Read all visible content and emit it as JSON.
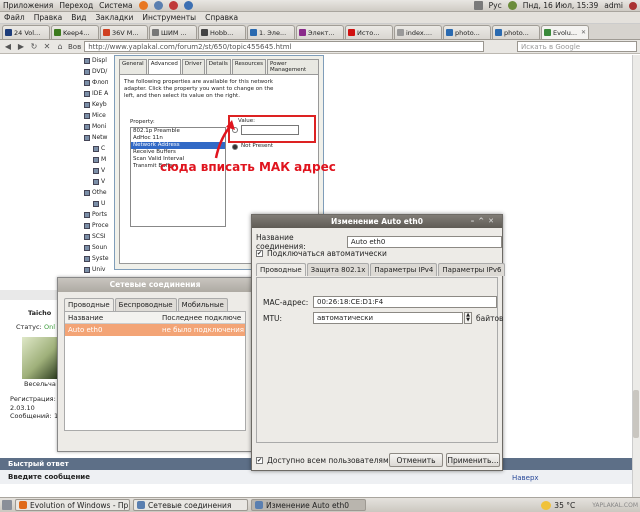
{
  "top_panel": {
    "menus": [
      "Приложения",
      "Переход",
      "Система"
    ],
    "layout": "Рус",
    "clock": "Пнд, 16 Июл, 15:39",
    "user": "admi"
  },
  "menubar": [
    "Файл",
    "Правка",
    "Вид",
    "Закладки",
    "Инструменты",
    "Справка"
  ],
  "tabs": [
    {
      "label": "24 Vol...",
      "color": "#1d3c7a"
    },
    {
      "label": "Keep4...",
      "color": "#3c7a1d"
    },
    {
      "label": "36V M...",
      "color": "#d04020"
    },
    {
      "label": "ШИМ ...",
      "color": "#777777"
    },
    {
      "label": "Hobb...",
      "color": "#444444"
    },
    {
      "label": "1. Эле...",
      "color": "#2a6ab0"
    },
    {
      "label": "Элект...",
      "color": "#8a2a8a"
    },
    {
      "label": "Исто...",
      "color": "#d01010"
    },
    {
      "label": "index....",
      "color": "#999999"
    },
    {
      "label": "photo...",
      "color": "#2a6ab0"
    },
    {
      "label": "photo...",
      "color": "#2a6ab0"
    },
    {
      "label": "Evolu...",
      "color": "#3a8a3a",
      "active": true
    }
  ],
  "navbar": {
    "url_prefix": "Вов",
    "url": "http://www.yaplakal.com/forum2/st/650/topic455645.html",
    "search_placeholder": "Искать в Google"
  },
  "device_tree": [
    "Displ",
    "DVD/",
    "Флоп",
    "IDE A",
    "Keyb",
    "Mice",
    "Moni",
    "Netw",
    "C",
    "M",
    "V",
    "V",
    "Othe",
    "U",
    "Ports",
    "Proce",
    "SCSI",
    "Soun",
    "Syste",
    "Univ"
  ],
  "prop_dialog": {
    "tabs": [
      "General",
      "Advanced",
      "Driver",
      "Details",
      "Resources",
      "Power Management"
    ],
    "description": "The following properties are available for this network adapter. Click the property you want to change on the left, and then select its value on the right.",
    "property_label": "Property:",
    "value_label": "Value:",
    "not_present": "Not Present",
    "properties": [
      "802.1p Preamble",
      "AdHoc 11n",
      "Network Address",
      "Receive Buffers",
      "Scan Valid Interval",
      "Transmit Buffers"
    ],
    "selected_index": 2
  },
  "annotation": "сюда вписать МАК адрес",
  "forum": {
    "username": "Taicho",
    "status_label": "Статус:",
    "status_value": "Onl",
    "caption": "Весельча",
    "reg_label": "Регистрация:",
    "reg_value": "2.03.10",
    "posts_label": "Сообщений:",
    "posts_value": "1",
    "quick_reply": "Быстрый ответ",
    "enter_message": "Введите сообщение",
    "up_link": "Наверх"
  },
  "connections_window": {
    "title": "Сетевые соединения",
    "tabs": [
      "Проводные",
      "Беспроводные",
      "Мобильные"
    ],
    "columns": [
      "Название",
      "Последнее подключе"
    ],
    "rows": [
      {
        "name": "Auto eth0",
        "last": "не было подключения"
      }
    ]
  },
  "edit_dialog": {
    "title": "Изменение Auto eth0",
    "name_label": "Название соединения:",
    "name_value": "Auto eth0",
    "auto_connect": "Подключаться автоматически",
    "tabs": [
      "Проводные",
      "Защита 802.1x",
      "Параметры IPv4",
      "Параметры IPv6"
    ],
    "mac_label": "MAC-адрес:",
    "mac_value": "00:26:18:CE:D1:F4",
    "mtu_label": "MTU:",
    "mtu_value": "автоматически",
    "mtu_unit": "байтов",
    "all_users": "Доступно всем пользователям",
    "cancel": "Отменить",
    "apply": "Применить..."
  },
  "taskbar": {
    "items": [
      {
        "label": "Evolution of Windows - Пр...",
        "color": "#e06a1a"
      },
      {
        "label": "Сетевые соединения",
        "color": "#5a7fb0"
      },
      {
        "label": "Изменение Auto eth0",
        "color": "#5a7fb0",
        "active": true
      }
    ],
    "temperature": "35 °C",
    "watermark": "YAPLAKAL.COM"
  }
}
